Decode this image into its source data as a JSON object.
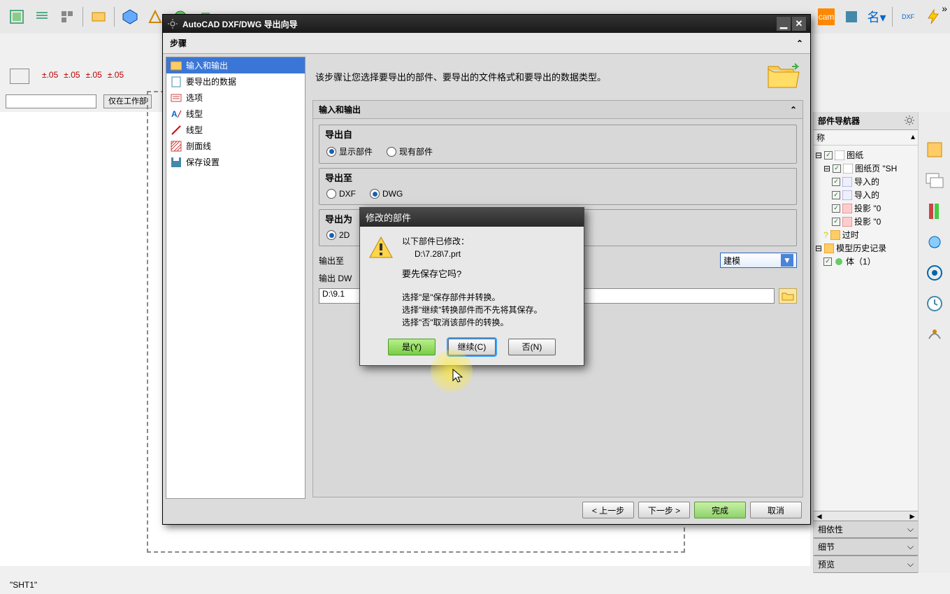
{
  "wizard": {
    "title": "AutoCAD DXF/DWG 导出向导",
    "steps_label": "步骤",
    "left_items": [
      "输入和输出",
      "要导出的数据",
      "选项",
      "线型",
      "线型",
      "剖面线",
      "保存设置"
    ],
    "desc": "该步骤让您选择要导出的部件、要导出的文件格式和要导出的数据类型。",
    "section_title": "输入和输出",
    "group_export_from": {
      "title": "导出自",
      "opt_display": "显示部件",
      "opt_existing": "现有部件"
    },
    "group_export_to": {
      "title": "导出至",
      "opt_dxf": "DXF",
      "opt_dwg": "DWG"
    },
    "group_export_as": {
      "title": "导出为",
      "opt_2d": "2D"
    },
    "out_to_label": "输出至",
    "out_dwg_label": "输出 DW",
    "out_select_value": "建模",
    "path_value": "D:\\9.1",
    "btn_prev": "< 上一步",
    "btn_next": "下一步 >",
    "btn_finish": "完成",
    "btn_cancel": "取消"
  },
  "modal": {
    "title": "修改的部件",
    "line1": "以下部件已修改：",
    "line2": "D:\\7.28\\7.prt",
    "question": "要先保存它吗?",
    "hint1": "选择\"是\"保存部件并转换。",
    "hint2": "选择\"继续\"转换部件而不先将其保存。",
    "hint3": "选择\"否\"取消该部件的转换。",
    "btn_yes": "是(Y)",
    "btn_continue": "继续(C)",
    "btn_no": "否(N)"
  },
  "right_panel": {
    "title": "部件导航器",
    "col": "称",
    "tree": {
      "drawing": "图纸",
      "sheet": "图纸页 \"SH",
      "import1": "导入的",
      "import2": "导入的",
      "proj1": "投影 \"0",
      "proj2": "投影 \"0",
      "outdated": "过时",
      "history": "模型历史记录",
      "body": "体（1）"
    },
    "sec_dependency": "相依性",
    "sec_detail": "细节",
    "sec_preview": "预览"
  },
  "left_btn": "仅在工作部",
  "status": "\"SHT1\"",
  "dims": {
    "a": "±.05",
    "b": "±.05",
    "c": "±.05",
    "d": "±.05"
  }
}
